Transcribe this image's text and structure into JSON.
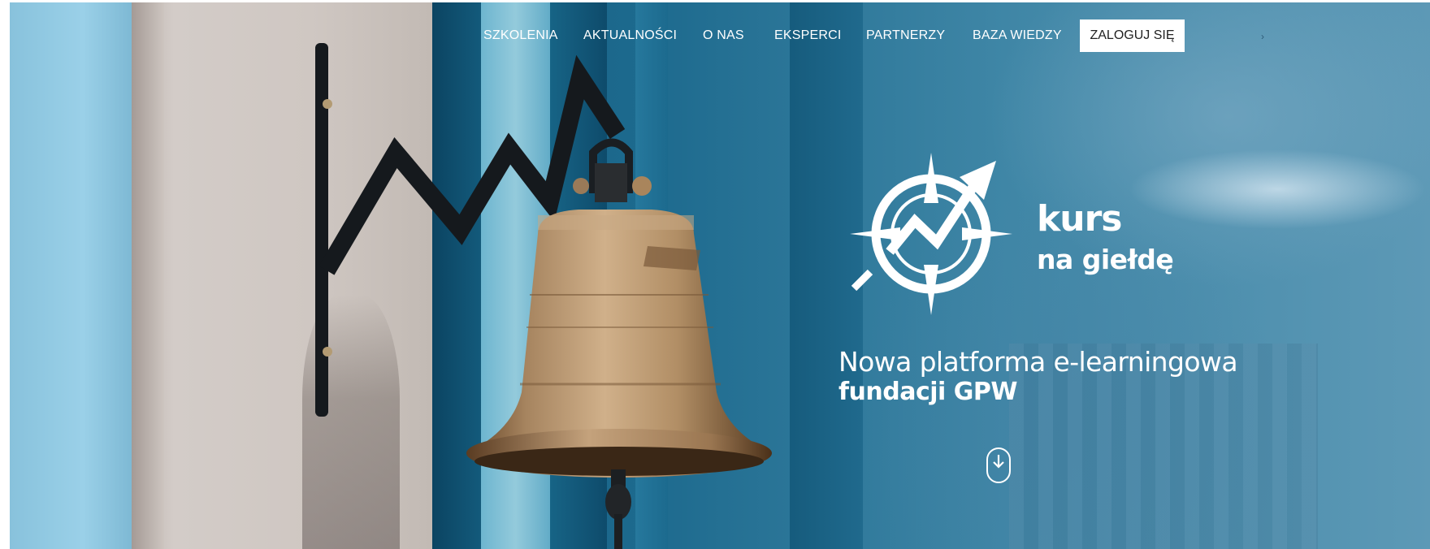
{
  "nav": {
    "items": [
      {
        "label": "SZKOLENIA"
      },
      {
        "label": "AKTUALNOŚCI"
      },
      {
        "label": "O NAS"
      },
      {
        "label": "EKSPERCI"
      },
      {
        "label": "PARTNERZY"
      },
      {
        "label": "BAZA WIEDZY"
      }
    ],
    "login_label": "ZALOGUJ SIĘ"
  },
  "logo": {
    "line1": "kurs",
    "line2": "na giełdę",
    "icon": "compass-chart-icon"
  },
  "hero": {
    "tagline_line1": "Nowa platforma e-learningowa",
    "tagline_line2": "fundacji GPW",
    "scroll_icon": "scroll-down-mouse-icon",
    "image": "bell-photo"
  },
  "colors": {
    "primary_bg": "#145c80",
    "text": "#ffffff",
    "button_bg": "#ffffff",
    "button_text": "#222222"
  }
}
